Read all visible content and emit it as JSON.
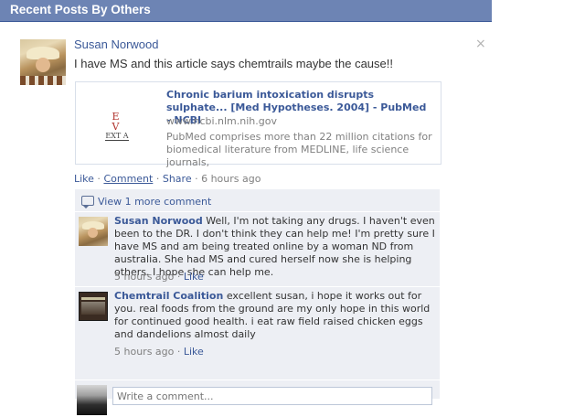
{
  "header": {
    "title": "Recent Posts By Others"
  },
  "post": {
    "author": "Susan Norwood",
    "close_glyph": "×",
    "text": "I have MS and this article says chemtrails maybe the cause!!",
    "attachment": {
      "thumb_top": "E V",
      "thumb_bottom": "EXT A",
      "title": "Chronic barium intoxication disrupts sulphate... [Med Hypotheses. 2004] - PubMed - NCBI",
      "url": "www.ncbi.nlm.nih.gov",
      "description": "PubMed comprises more than 22 million citations for biomedical literature from MEDLINE, life science journals,"
    },
    "actions": {
      "like": "Like",
      "sep1": " · ",
      "comment": "Comment",
      "sep2": " · ",
      "share": "Share",
      "sep3": " · ",
      "time": "6 hours ago"
    }
  },
  "comments": {
    "view_more": "View 1 more comment",
    "items": [
      {
        "author": "Susan Norwood",
        "text": "Well, I'm not taking any drugs. I haven't even been to the DR. I don't think they can help me! I'm pretty sure I have MS and am being treated online by a woman ND from australia. She had MS and cured herself now she is helping others. I hope she can help me.",
        "time": "5 hours ago",
        "sep": " · ",
        "like": "Like"
      },
      {
        "author": "Chemtrail Coalition",
        "text": "excellent susan, i hope it works out for you. real foods from the ground are my only hope in this world for continued good health. i eat raw field raised chicken eggs and dandelions almost daily",
        "time": "5 hours ago",
        "sep": " · ",
        "like": "Like"
      }
    ],
    "write_placeholder": "Write a comment..."
  },
  "colors": {
    "header_bg": "#6d84b4",
    "link": "#3b5998",
    "comment_bg": "#edeff4",
    "muted": "#808080"
  },
  "icons": [
    "close-icon",
    "comment-bubble-icon"
  ]
}
